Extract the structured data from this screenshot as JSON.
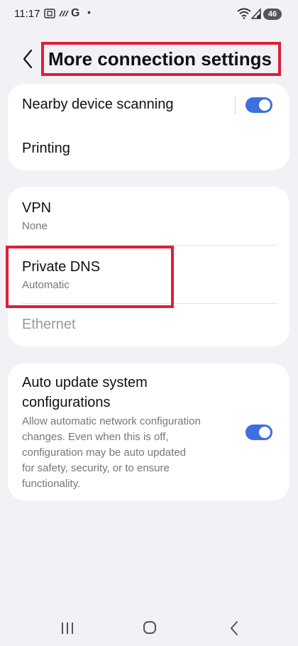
{
  "status_bar": {
    "time": "11:17",
    "carrier_glyph": "G",
    "dot": "•",
    "battery": "46",
    "icons": [
      "screenshot-icon",
      "nfc-icon",
      "wifi-icon",
      "signal-icon"
    ]
  },
  "header": {
    "title": "More connection settings",
    "back_icon": "chevron-left-icon"
  },
  "groups": [
    {
      "items": [
        {
          "title": "Nearby device scanning",
          "toggle": true
        },
        {
          "title": "Printing"
        }
      ]
    },
    {
      "items": [
        {
          "title": "VPN",
          "subtitle": "None"
        },
        {
          "title": "Private DNS",
          "subtitle": "Automatic"
        },
        {
          "title": "Ethernet",
          "disabled": true
        }
      ]
    },
    {
      "items": [
        {
          "title_line1": "Auto update system",
          "title_line2": "configurations",
          "description_lines": [
            "Allow automatic network configuration",
            "changes. Even when this is off,",
            "configuration may be auto updated",
            "for safety, security, or to ensure",
            "functionality."
          ],
          "toggle": true
        }
      ]
    }
  ],
  "colors": {
    "background": "#f2f2f6",
    "accent": "#3e6fe1",
    "highlight": "#e01e37"
  },
  "nav_bar": {
    "icons": [
      "recent-apps-icon",
      "home-icon",
      "back-icon"
    ]
  }
}
